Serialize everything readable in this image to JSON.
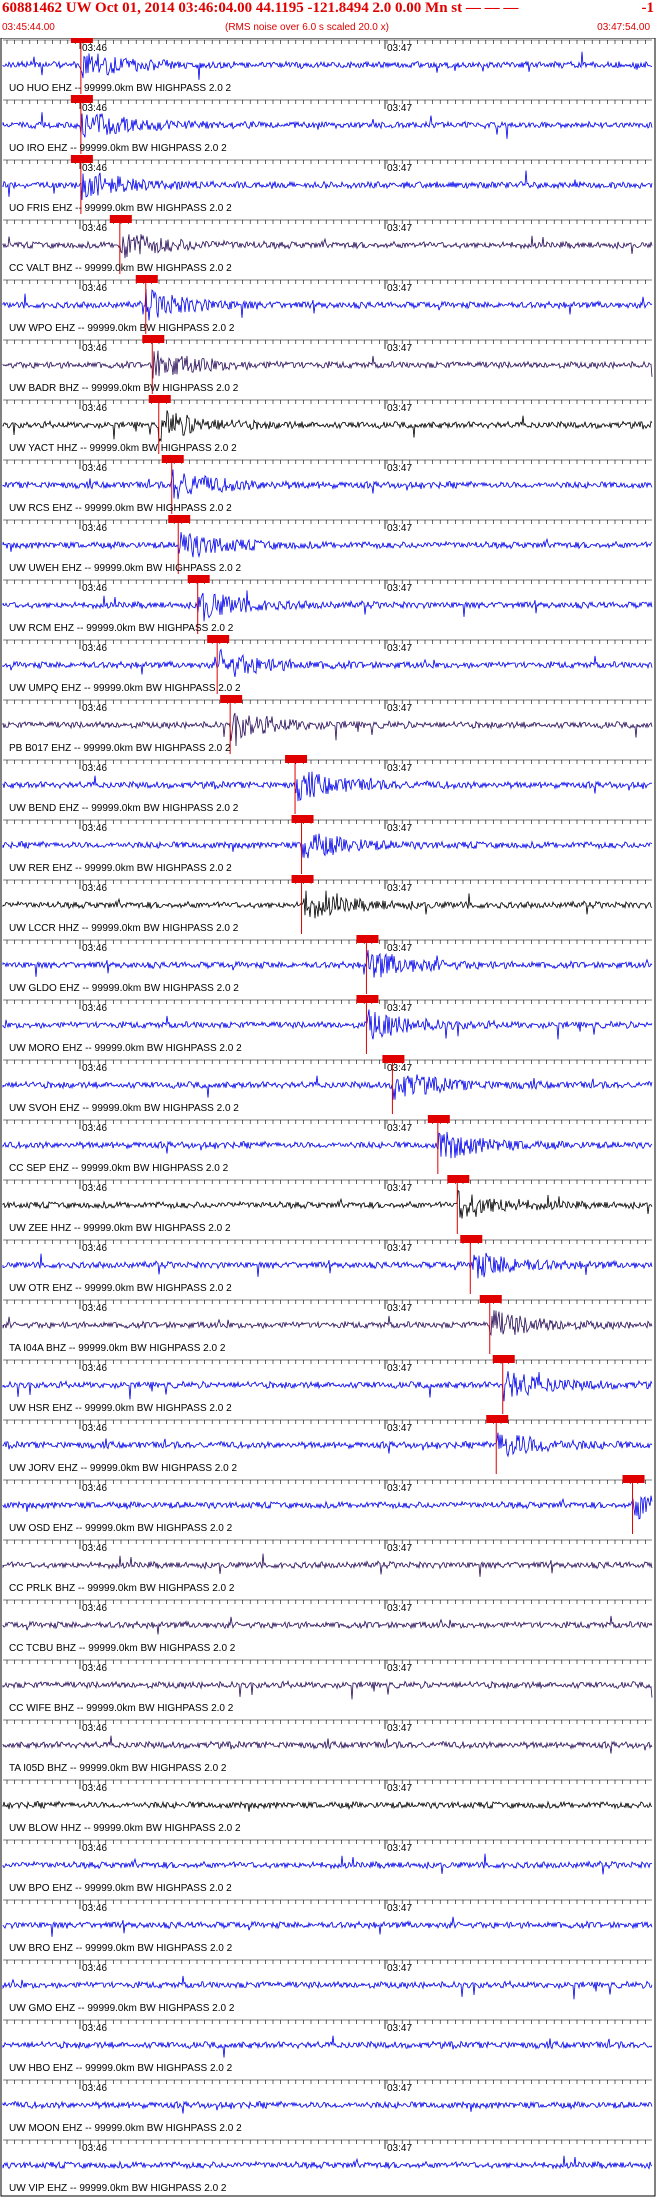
{
  "header": {
    "title": "60881462 UW Oct 01, 2014 03:46:04.00   44.1195 -121.8494  2.0 0.00 Mn st — — —",
    "title_right": "-1",
    "start_time": "03:45:44.00",
    "note": "(RMS noise over 6.0 s scaled 20.0 x)",
    "end_time": "03:47:54.00"
  },
  "colors": {
    "blue": "#0000ee",
    "purple": "#2a0f5a",
    "black": "#000000",
    "pick": "#e00000"
  },
  "chart_data": {
    "type": "line",
    "title": "60881462 UW Oct 01, 2014 03:46:04.00",
    "tick_labels": [
      "03:46",
      "03:47"
    ],
    "traces": [
      {
        "label": "UO HUO EHZ -- 99999.0km BW  HIGHPASS  2.0  2",
        "color": "blue",
        "pick": true,
        "event": 0.12
      },
      {
        "label": "UO IRO EHZ -- 99999.0km BW  HIGHPASS  2.0  2",
        "color": "blue",
        "pick": true,
        "event": 0.12
      },
      {
        "label": "UO FRIS EHZ -- 99999.0km BW  HIGHPASS  2.0  2",
        "color": "blue",
        "pick": true,
        "event": 0.12
      },
      {
        "label": "CC VALT BHZ -- 99999.0km BW  HIGHPASS  2.0  2",
        "color": "purple",
        "pick": true,
        "event": 0.18
      },
      {
        "label": "UW WPO EHZ -- 99999.0km BW  HIGHPASS  2.0  2",
        "color": "blue",
        "pick": true,
        "event": 0.22
      },
      {
        "label": "UW BADR BHZ -- 99999.0km BW  HIGHPASS  2.0  2",
        "color": "purple",
        "pick": true,
        "event": 0.23
      },
      {
        "label": "UW YACT HHZ -- 99999.0km BW  HIGHPASS  2.0  2",
        "color": "black",
        "pick": true,
        "event": 0.24
      },
      {
        "label": "UW RCS EHZ -- 99999.0km BW  HIGHPASS  2.0  2",
        "color": "blue",
        "pick": true,
        "event": 0.26
      },
      {
        "label": "UW UWEH EHZ -- 99999.0km BW  HIGHPASS  2.0  2",
        "color": "blue",
        "pick": true,
        "event": 0.27
      },
      {
        "label": "UW RCM EHZ -- 99999.0km BW  HIGHPASS  2.0  2",
        "color": "blue",
        "pick": true,
        "event": 0.3
      },
      {
        "label": "UW UMPQ EHZ -- 99999.0km BW  HIGHPASS  2.0  2",
        "color": "blue",
        "pick": true,
        "event": 0.33
      },
      {
        "label": "PB B017 EHZ -- 99999.0km BW  HIGHPASS  2.0  2",
        "color": "purple",
        "pick": true,
        "event": 0.35
      },
      {
        "label": "UW BEND EHZ -- 99999.0km BW  HIGHPASS  2.0  2",
        "color": "blue",
        "pick": true,
        "event": 0.45
      },
      {
        "label": "UW RER EHZ -- 99999.0km BW  HIGHPASS  2.0  2",
        "color": "blue",
        "pick": true,
        "event": 0.46
      },
      {
        "label": "UW LCCR HHZ -- 99999.0km BW  HIGHPASS  2.0  2",
        "color": "black",
        "pick": true,
        "event": 0.46
      },
      {
        "label": "UW GLDO EHZ -- 99999.0km BW  HIGHPASS  2.0  2",
        "color": "blue",
        "pick": true,
        "event": 0.56
      },
      {
        "label": "UW MORO EHZ -- 99999.0km BW  HIGHPASS  2.0  2",
        "color": "blue",
        "pick": true,
        "event": 0.56
      },
      {
        "label": "UW SVOH EHZ -- 99999.0km BW  HIGHPASS  2.0  2",
        "color": "blue",
        "pick": true,
        "event": 0.6
      },
      {
        "label": "CC SEP EHZ -- 99999.0km BW  HIGHPASS  2.0  2",
        "color": "blue",
        "pick": true,
        "event": 0.67
      },
      {
        "label": "UW ZEE HHZ -- 99999.0km BW  HIGHPASS  2.0  2",
        "color": "black",
        "pick": true,
        "event": 0.7
      },
      {
        "label": "UW OTR EHZ -- 99999.0km BW  HIGHPASS  2.0  2",
        "color": "blue",
        "pick": true,
        "event": 0.72
      },
      {
        "label": "TA I04A BHZ -- 99999.0km BW  HIGHPASS  2.0  2",
        "color": "purple",
        "pick": true,
        "event": 0.75
      },
      {
        "label": "UW HSR EHZ -- 99999.0km BW  HIGHPASS  2.0  2",
        "color": "blue",
        "pick": true,
        "event": 0.77
      },
      {
        "label": "UW JORV EHZ -- 99999.0km BW  HIGHPASS  2.0  2",
        "color": "blue",
        "pick": true,
        "event": 0.76
      },
      {
        "label": "UW OSD EHZ -- 99999.0km BW  HIGHPASS  2.0  2",
        "color": "blue",
        "pick": true,
        "event": 0.97
      },
      {
        "label": "CC PRLK BHZ -- 99999.0km BW  HIGHPASS  2.0  2",
        "color": "purple",
        "pick": false,
        "event": null
      },
      {
        "label": "CC TCBU BHZ -- 99999.0km BW  HIGHPASS  2.0  2",
        "color": "purple",
        "pick": false,
        "event": null
      },
      {
        "label": "CC WIFE BHZ -- 99999.0km BW  HIGHPASS  2.0  2",
        "color": "purple",
        "pick": false,
        "event": null
      },
      {
        "label": "TA I05D BHZ -- 99999.0km BW  HIGHPASS  2.0  2",
        "color": "purple",
        "pick": false,
        "event": null
      },
      {
        "label": "UW BLOW HHZ -- 99999.0km BW  HIGHPASS  2.0  2",
        "color": "black",
        "pick": false,
        "event": null
      },
      {
        "label": "UW BPO EHZ -- 99999.0km BW  HIGHPASS  2.0  2",
        "color": "blue",
        "pick": false,
        "event": null
      },
      {
        "label": "UW BRO EHZ -- 99999.0km BW  HIGHPASS  2.0  2",
        "color": "blue",
        "pick": false,
        "event": null
      },
      {
        "label": "UW GMO EHZ -- 99999.0km BW  HIGHPASS  2.0  2",
        "color": "blue",
        "pick": false,
        "event": null
      },
      {
        "label": "UW HBO EHZ -- 99999.0km BW  HIGHPASS  2.0  2",
        "color": "blue",
        "pick": false,
        "event": null
      },
      {
        "label": "UW MOON EHZ -- 99999.0km BW  HIGHPASS  2.0  2",
        "color": "blue",
        "pick": false,
        "event": null
      },
      {
        "label": "UW VIP EHZ -- 99999.0km BW  HIGHPASS  2.0  2",
        "color": "blue",
        "pick": false,
        "event": null
      }
    ]
  }
}
